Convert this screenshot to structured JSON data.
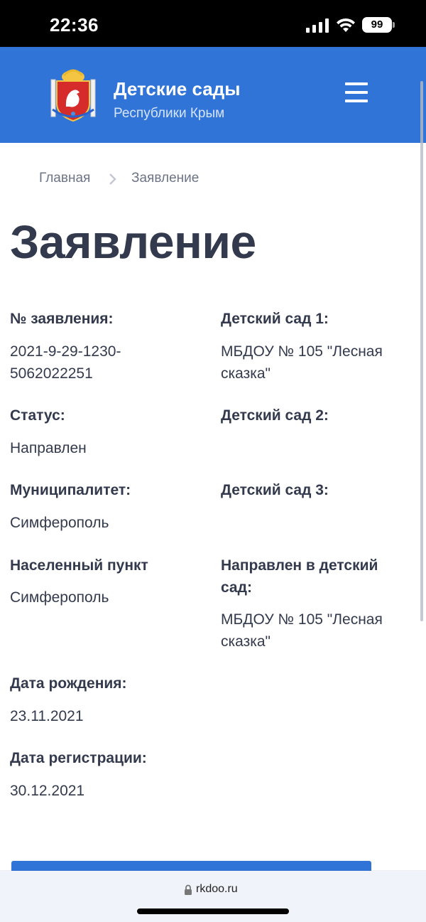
{
  "status_bar": {
    "time": "22:36",
    "battery": "99"
  },
  "header": {
    "title": "Детские сады",
    "subtitle": "Республики Крым",
    "brand_color": "#3174d8",
    "logo_icon": "crimea-coat-of-arms-icon",
    "menu_icon": "hamburger-menu-icon"
  },
  "breadcrumb": {
    "home": "Главная",
    "current": "Заявление"
  },
  "page_title": "Заявление",
  "fields": {
    "application_number": {
      "label": "№ заявления:",
      "value_line1": "2021-9-29-1230-",
      "value_line2": "5062022251"
    },
    "status": {
      "label": "Статус:",
      "value": "Направлен"
    },
    "municipality": {
      "label": "Муниципалитет:",
      "value": "Симферополь"
    },
    "locality": {
      "label": "Населенный пункт",
      "value": "Симферополь"
    },
    "birth_date": {
      "label": "Дата рождения:",
      "value": "23.11.2021"
    },
    "registration_date": {
      "label": "Дата регистрации:",
      "value": "30.12.2021"
    },
    "kindergarten_1": {
      "label": "Детский сад 1:",
      "value_line1": "МБДОУ № 105 \"Лесная",
      "value_line2": "сказка\""
    },
    "kindergarten_2": {
      "label": "Детский сад 2:"
    },
    "kindergarten_3": {
      "label": "Детский сад 3:"
    },
    "assigned_kindergarten": {
      "label_line1": "Направлен в детский",
      "label_line2": "сад:",
      "value_line1": "МБДОУ № 105 \"Лесная",
      "value_line2": "сказка\""
    }
  },
  "browser": {
    "url": "rkdoo.ru"
  }
}
